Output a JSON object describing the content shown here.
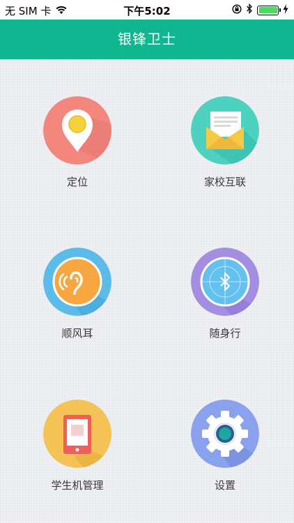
{
  "status": {
    "carrier": "无 SIM 卡",
    "time": "下午5:02",
    "icons": [
      "wifi-icon",
      "orientation-lock-icon",
      "bluetooth-icon",
      "battery-icon",
      "charging-icon"
    ]
  },
  "nav": {
    "title": "银锋卫士"
  },
  "colors": {
    "nav": "#10b68f",
    "location": "#f3877e",
    "school": "#4ed2c0",
    "ear": "#5bbbe9",
    "follow": "#a48ee2",
    "student": "#f5c355",
    "settings": "#8aa2ee"
  },
  "menu": [
    {
      "label": "定位",
      "icon": "location-pin-icon"
    },
    {
      "label": "家校互联",
      "icon": "envelope-icon"
    },
    {
      "label": "顺风耳",
      "icon": "ear-icon"
    },
    {
      "label": "随身行",
      "icon": "bluetooth-radar-icon"
    },
    {
      "label": "学生机管理",
      "icon": "phone-device-icon"
    },
    {
      "label": "设置",
      "icon": "gear-icon"
    }
  ]
}
